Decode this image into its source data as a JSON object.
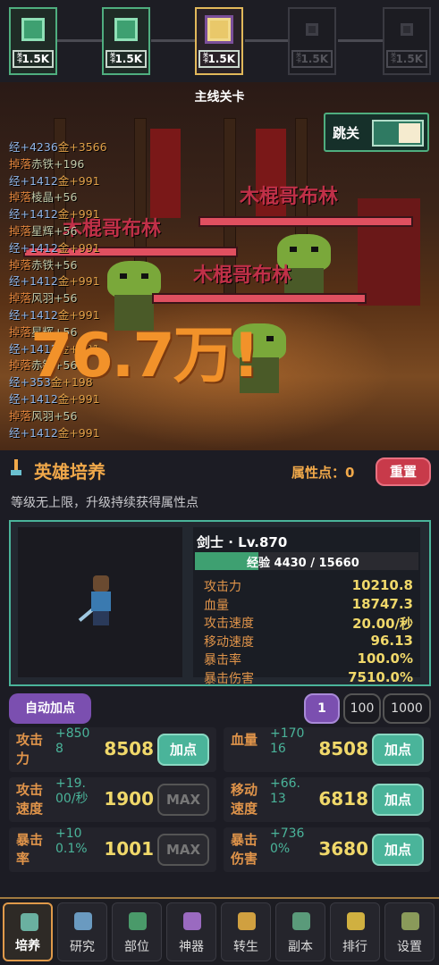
{
  "stages": [
    {
      "label": "1.5K",
      "tag": "关卡",
      "state": "done"
    },
    {
      "label": "1.5K",
      "tag": "关卡",
      "state": "done"
    },
    {
      "label": "1.5K",
      "tag": "关卡",
      "state": "current"
    },
    {
      "label": "1.5K",
      "tag": "关卡",
      "state": "locked"
    },
    {
      "label": "1.5K",
      "tag": "关卡",
      "state": "locked"
    }
  ],
  "scene": {
    "title": "主线关卡",
    "skip_label": "跳关",
    "skip_on": true,
    "damage": "76.7万!",
    "log": [
      {
        "a": "经+4236",
        "b": "金+3566",
        "type": "gain"
      },
      {
        "a": "掉落",
        "b": "赤铁+196",
        "type": "drop"
      },
      {
        "a": "经+1412",
        "b": "金+991",
        "type": "gain"
      },
      {
        "a": "掉落",
        "b": "棱晶+56",
        "type": "drop"
      },
      {
        "a": "经+1412",
        "b": "金+991",
        "type": "gain"
      },
      {
        "a": "掉落",
        "b": "星辉+56",
        "type": "drop"
      },
      {
        "a": "经+1412",
        "b": "金+991",
        "type": "gain"
      },
      {
        "a": "掉落",
        "b": "赤铁+56",
        "type": "drop"
      },
      {
        "a": "经+1412",
        "b": "金+991",
        "type": "gain"
      },
      {
        "a": "掉落",
        "b": "风羽+56",
        "type": "drop"
      },
      {
        "a": "经+1412",
        "b": "金+991",
        "type": "gain"
      },
      {
        "a": "掉落",
        "b": "星辉+56",
        "type": "drop"
      },
      {
        "a": "经+1412",
        "b": "金+991",
        "type": "gain"
      },
      {
        "a": "掉落",
        "b": "赤铁+56",
        "type": "drop"
      },
      {
        "a": "经+353",
        "b": "金+198",
        "type": "gain"
      },
      {
        "a": "经+1412",
        "b": "金+991",
        "type": "gain"
      },
      {
        "a": "掉落",
        "b": "风羽+56",
        "type": "drop"
      },
      {
        "a": "经+1412",
        "b": "金+991",
        "type": "gain"
      }
    ],
    "enemies": [
      {
        "name": "木棍哥布林",
        "hp": 1.0
      },
      {
        "name": "木棍哥布林",
        "hp": 1.0
      },
      {
        "name": "木棍哥布林",
        "hp": 1.0
      }
    ]
  },
  "hero": {
    "title": "英雄培养",
    "points_label": "属性点：",
    "points": "0",
    "reset_label": "重置",
    "hint": "等级无上限，升级持续获得属性点",
    "class_level": "剑士 · Lv.870",
    "xp_label": "经验",
    "xp_text": "4430 / 15660",
    "xp_fraction": 0.283,
    "stats": [
      {
        "k": "攻击力",
        "v": "10210.8"
      },
      {
        "k": "血量",
        "v": "18747.3"
      },
      {
        "k": "攻击速度",
        "v": "20.00/秒"
      },
      {
        "k": "移动速度",
        "v": "96.13"
      },
      {
        "k": "暴击率",
        "v": "100.0%"
      },
      {
        "k": "暴击伤害",
        "v": "7510.0%"
      }
    ],
    "auto_label": "自动加点",
    "multipliers": [
      "1",
      "100",
      "1000"
    ],
    "multiplier_selected": "1",
    "attrs": [
      {
        "name": "攻击力",
        "delta": "+8508",
        "value": "8508",
        "btn": "加点",
        "max": false
      },
      {
        "name": "血量",
        "delta": "+17016",
        "value": "8508",
        "btn": "加点",
        "max": false
      },
      {
        "name": "攻击速度",
        "delta": "+19.00/秒",
        "value": "1900",
        "btn": "MAX",
        "max": true
      },
      {
        "name": "移动速度",
        "delta": "+66.13",
        "value": "6818",
        "btn": "加点",
        "max": false
      },
      {
        "name": "暴击率",
        "delta": "+100.1%",
        "value": "1001",
        "btn": "MAX",
        "max": true
      },
      {
        "name": "暴击伤害",
        "delta": "+7360%",
        "value": "3680",
        "btn": "加点",
        "max": false
      }
    ]
  },
  "nav": [
    {
      "label": "培养",
      "icon": "potion-icon",
      "color": "#6ab0a0",
      "active": true
    },
    {
      "label": "研究",
      "icon": "research-icon",
      "color": "#6a9ac0",
      "active": false
    },
    {
      "label": "部位",
      "icon": "armor-icon",
      "color": "#4a9a6a",
      "active": false
    },
    {
      "label": "神器",
      "icon": "artifact-icon",
      "color": "#9a6ac0",
      "active": false
    },
    {
      "label": "转生",
      "icon": "rebirth-icon",
      "color": "#d0a040",
      "active": false
    },
    {
      "label": "副本",
      "icon": "dungeon-icon",
      "color": "#5a9a7a",
      "active": false
    },
    {
      "label": "排行",
      "icon": "crown-icon",
      "color": "#d0b040",
      "active": false
    },
    {
      "label": "设置",
      "icon": "gear-icon",
      "color": "#8a9a5a",
      "active": false
    }
  ]
}
